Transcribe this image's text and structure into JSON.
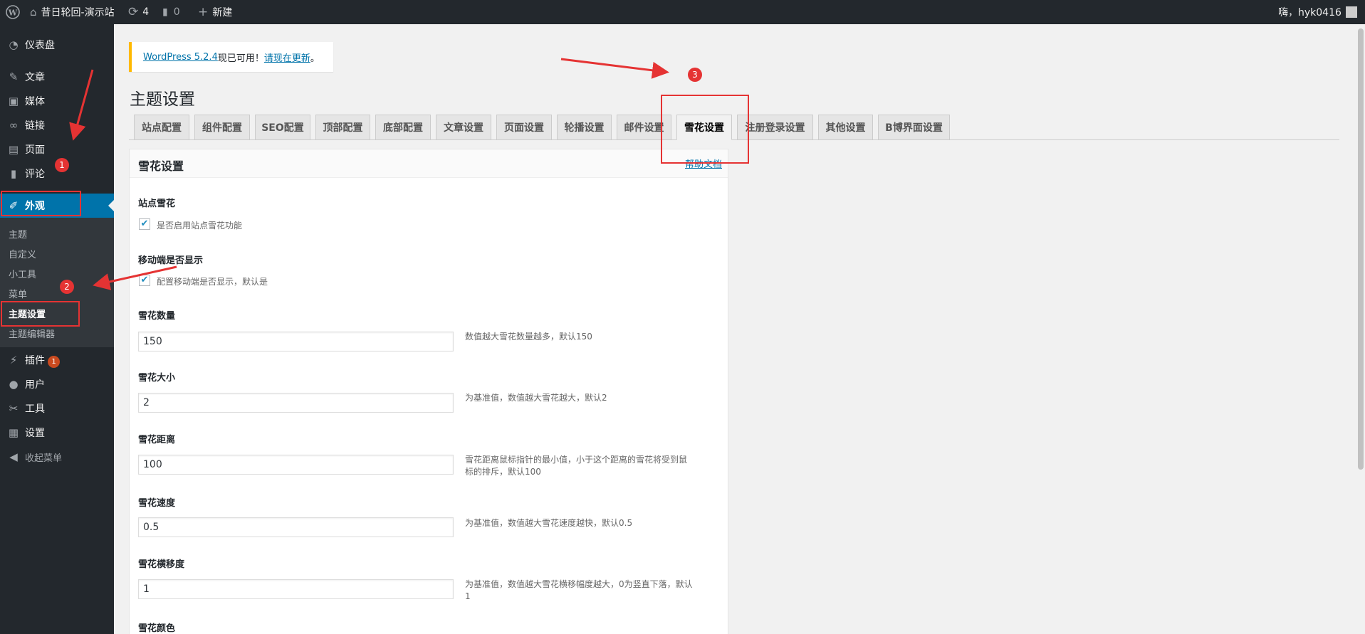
{
  "admin_bar": {
    "site_name": "昔日轮回-演示站",
    "updates_count": "4",
    "comments_count": "0",
    "new_label": "新建",
    "greeting": "嗨，hyk0416"
  },
  "sidebar": {
    "items": [
      {
        "label": "仪表盘",
        "icon": "dashboard-icon"
      },
      {
        "label": "文章",
        "icon": "pin-icon"
      },
      {
        "label": "媒体",
        "icon": "media-icon"
      },
      {
        "label": "链接",
        "icon": "link-icon"
      },
      {
        "label": "页面",
        "icon": "page-icon"
      },
      {
        "label": "评论",
        "icon": "comment-icon"
      },
      {
        "label": "外观",
        "icon": "brush-icon"
      },
      {
        "label": "插件",
        "icon": "plugin-icon",
        "badge": "1"
      },
      {
        "label": "用户",
        "icon": "user-icon"
      },
      {
        "label": "工具",
        "icon": "wrench-icon"
      },
      {
        "label": "设置",
        "icon": "settings-icon"
      },
      {
        "label": "收起菜单",
        "icon": "collapse-icon"
      }
    ],
    "submenu": [
      "主题",
      "自定义",
      "小工具",
      "菜单",
      "主题设置",
      "主题编辑器"
    ]
  },
  "notice": {
    "link1": "WordPress 5.2.4",
    "text": "现已可用！",
    "link2": "请现在更新",
    "end": "。"
  },
  "page_title": "主题设置",
  "tabs": [
    "站点配置",
    "组件配置",
    "SEO配置",
    "顶部配置",
    "底部配置",
    "文章设置",
    "页面设置",
    "轮播设置",
    "邮件设置",
    "雪花设置",
    "注册登录设置",
    "其他设置",
    "B博界面设置"
  ],
  "active_tab": "雪花设置",
  "panel": {
    "title": "雪花设置",
    "help": "帮助文档",
    "site_snow_label": "站点雪花",
    "site_snow_desc": "是否启用站点雪花功能",
    "mobile_label": "移动端是否显示",
    "mobile_desc": "配置移动端是否显示，默认是",
    "fields": [
      {
        "label": "雪花数量",
        "value": "150",
        "desc": "数值越大雪花数量越多，默认150"
      },
      {
        "label": "雪花大小",
        "value": "2",
        "desc": "为基准值，数值越大雪花越大，默认2"
      },
      {
        "label": "雪花距离",
        "value": "100",
        "desc": "雪花距离鼠标指针的最小值，小于这个距离的雪花将受到鼠标的排斥，默认100"
      },
      {
        "label": "雪花速度",
        "value": "0.5",
        "desc": "为基准值，数值越大雪花速度越快，默认0.5"
      },
      {
        "label": "雪花横移度",
        "value": "1",
        "desc": "为基准值，数值越大雪花横移幅度越大，0为竖直下落，默认1"
      }
    ],
    "color_label": "雪花颜色"
  },
  "annotations": [
    "1",
    "2",
    "3"
  ],
  "colors": {
    "accent": "#0073aa",
    "annotation": "#e53333",
    "adminbar": "#23282d"
  }
}
